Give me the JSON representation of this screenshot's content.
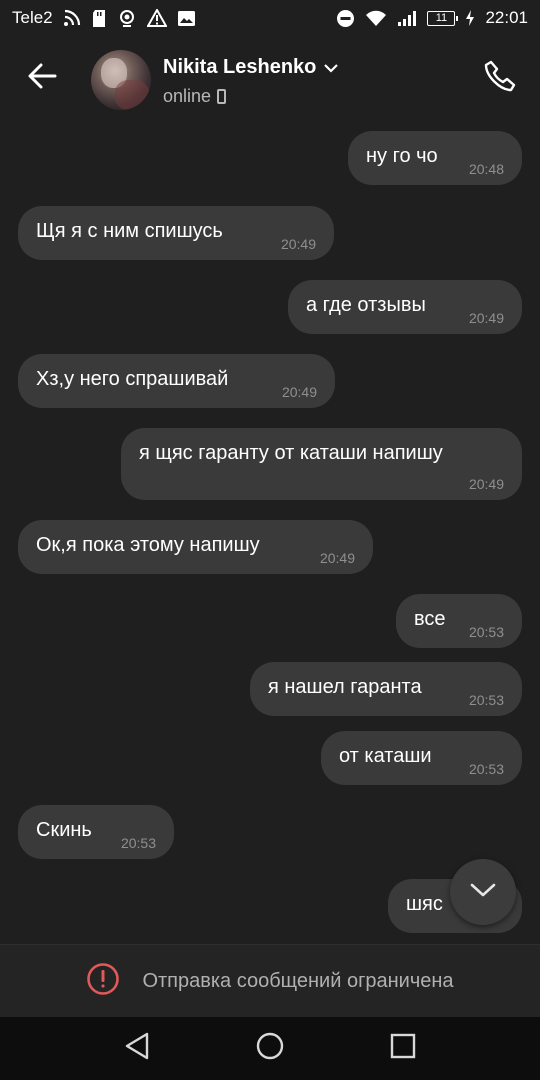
{
  "status_bar": {
    "carrier": "Tele2",
    "battery": "11",
    "time": "22:01"
  },
  "header": {
    "contact_name": "Nikita Leshenko",
    "status": "online"
  },
  "messages": [
    {
      "side": "out",
      "text": "ну го чо",
      "time": "20:48"
    },
    {
      "side": "in",
      "text": "Щя я с ним спишусь",
      "time": "20:49"
    },
    {
      "side": "out",
      "text": "а где отзывы",
      "time": "20:49"
    },
    {
      "side": "in",
      "text": "Хз,у него спрашивай",
      "time": "20:49"
    },
    {
      "side": "out",
      "text": "я щяс гаранту от каташи напишу",
      "time": "20:49"
    },
    {
      "side": "in",
      "text": "Ок,я пока этому напишу",
      "time": "20:49"
    },
    {
      "side": "out",
      "text": "все",
      "time": "20:53"
    },
    {
      "side": "out",
      "text": "я нашел гаранта",
      "time": "20:53"
    },
    {
      "side": "out",
      "text": "от каташи",
      "time": "20:53"
    },
    {
      "side": "in",
      "text": "Скинь",
      "time": "20:53"
    },
    {
      "side": "out",
      "text": "шяс",
      "time": ""
    }
  ],
  "restriction": {
    "text": "Отправка сообщений ограничена",
    "icon": "alert-circle-icon",
    "icon_color": "#e05a5a"
  },
  "colors": {
    "background": "#1f1f1f",
    "bubble": "#3a3a3a",
    "time_text": "#8f8f8f"
  }
}
